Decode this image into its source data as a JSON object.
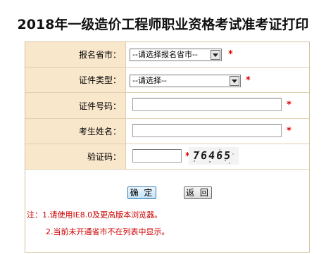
{
  "page": {
    "title": "2018年一级造价工程师职业资格考试准考证打印"
  },
  "form": {
    "province": {
      "label": "报名省市：",
      "selected": "--请选择报名省市--",
      "required_mark": "*"
    },
    "id_type": {
      "label": "证件类型：",
      "selected": "--请选择--",
      "required_mark": "*"
    },
    "id_number": {
      "label": "证件号码：",
      "value": "",
      "required_mark": "*"
    },
    "name": {
      "label": "考生姓名：",
      "value": "",
      "required_mark": "*"
    },
    "captcha": {
      "label": "验证码：",
      "value": "",
      "required_mark": "*",
      "code": "76465"
    }
  },
  "buttons": {
    "confirm": "确 定",
    "back": "返 回"
  },
  "notes": {
    "line1": "注：1.请使用IE8.0及更高版本浏览器。",
    "line2": "2.当前未开通省市不在列表中显示。"
  },
  "colors": {
    "label_bg": "#f9e7cc",
    "border": "#d7bf9e",
    "required": "#e00000",
    "note_text": "#cc0000"
  }
}
